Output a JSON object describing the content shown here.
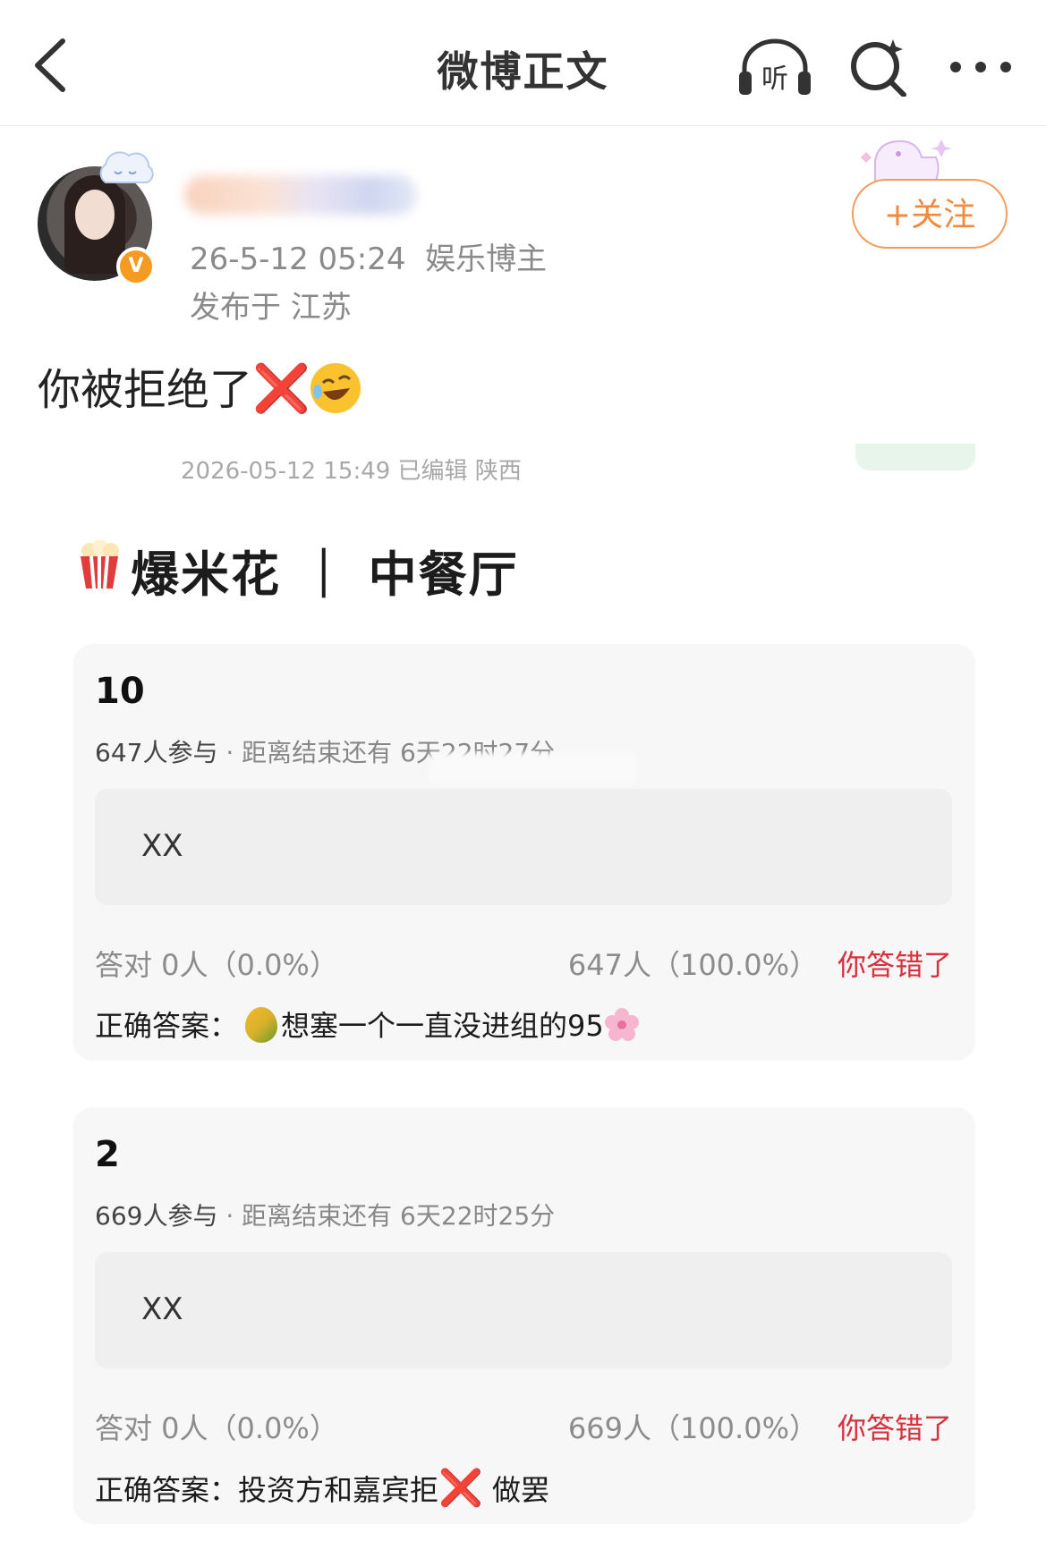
{
  "header": {
    "title": "微博正文",
    "listen_label": "听"
  },
  "post": {
    "timestamp": "26-5-12 05:24",
    "author_tag": "娱乐博主",
    "location": "发布于 江苏",
    "follow_label": "+关注",
    "text": "你被拒绝了",
    "cross_emoji": "❌",
    "laugh_emoji": "🤣",
    "verified_badge": "V"
  },
  "embedded": {
    "meta": "2026-05-12 15:49 已编辑 陕西",
    "section_title": "爆米花 ｜ 中餐厅",
    "quizzes": [
      {
        "title": "10",
        "participants": "647人参与",
        "countdown": "· 距离结束还有 6天22时27分",
        "option": "XX",
        "correct_stat": "答对  0人（0.0%）",
        "wrong_stat": "647人（100.0%）",
        "result": "你答错了",
        "answer_label": "正确答案：",
        "answer_text": "想塞一个一直没进组的95"
      },
      {
        "title": "2",
        "participants": "669人参与",
        "countdown": "· 距离结束还有 6天22时25分",
        "option": "XX",
        "correct_stat": "答对  0人（0.0%）",
        "wrong_stat": "669人（100.0%）",
        "result": "你答错了",
        "answer_label": "正确答案：",
        "answer_text_a": "投资方和嘉宾拒",
        "answer_text_b": " 做罢"
      }
    ]
  },
  "colors": {
    "accent_orange": "#f08a3c",
    "wrong_red": "#d8303c",
    "card_bg": "#f7f7f7"
  }
}
